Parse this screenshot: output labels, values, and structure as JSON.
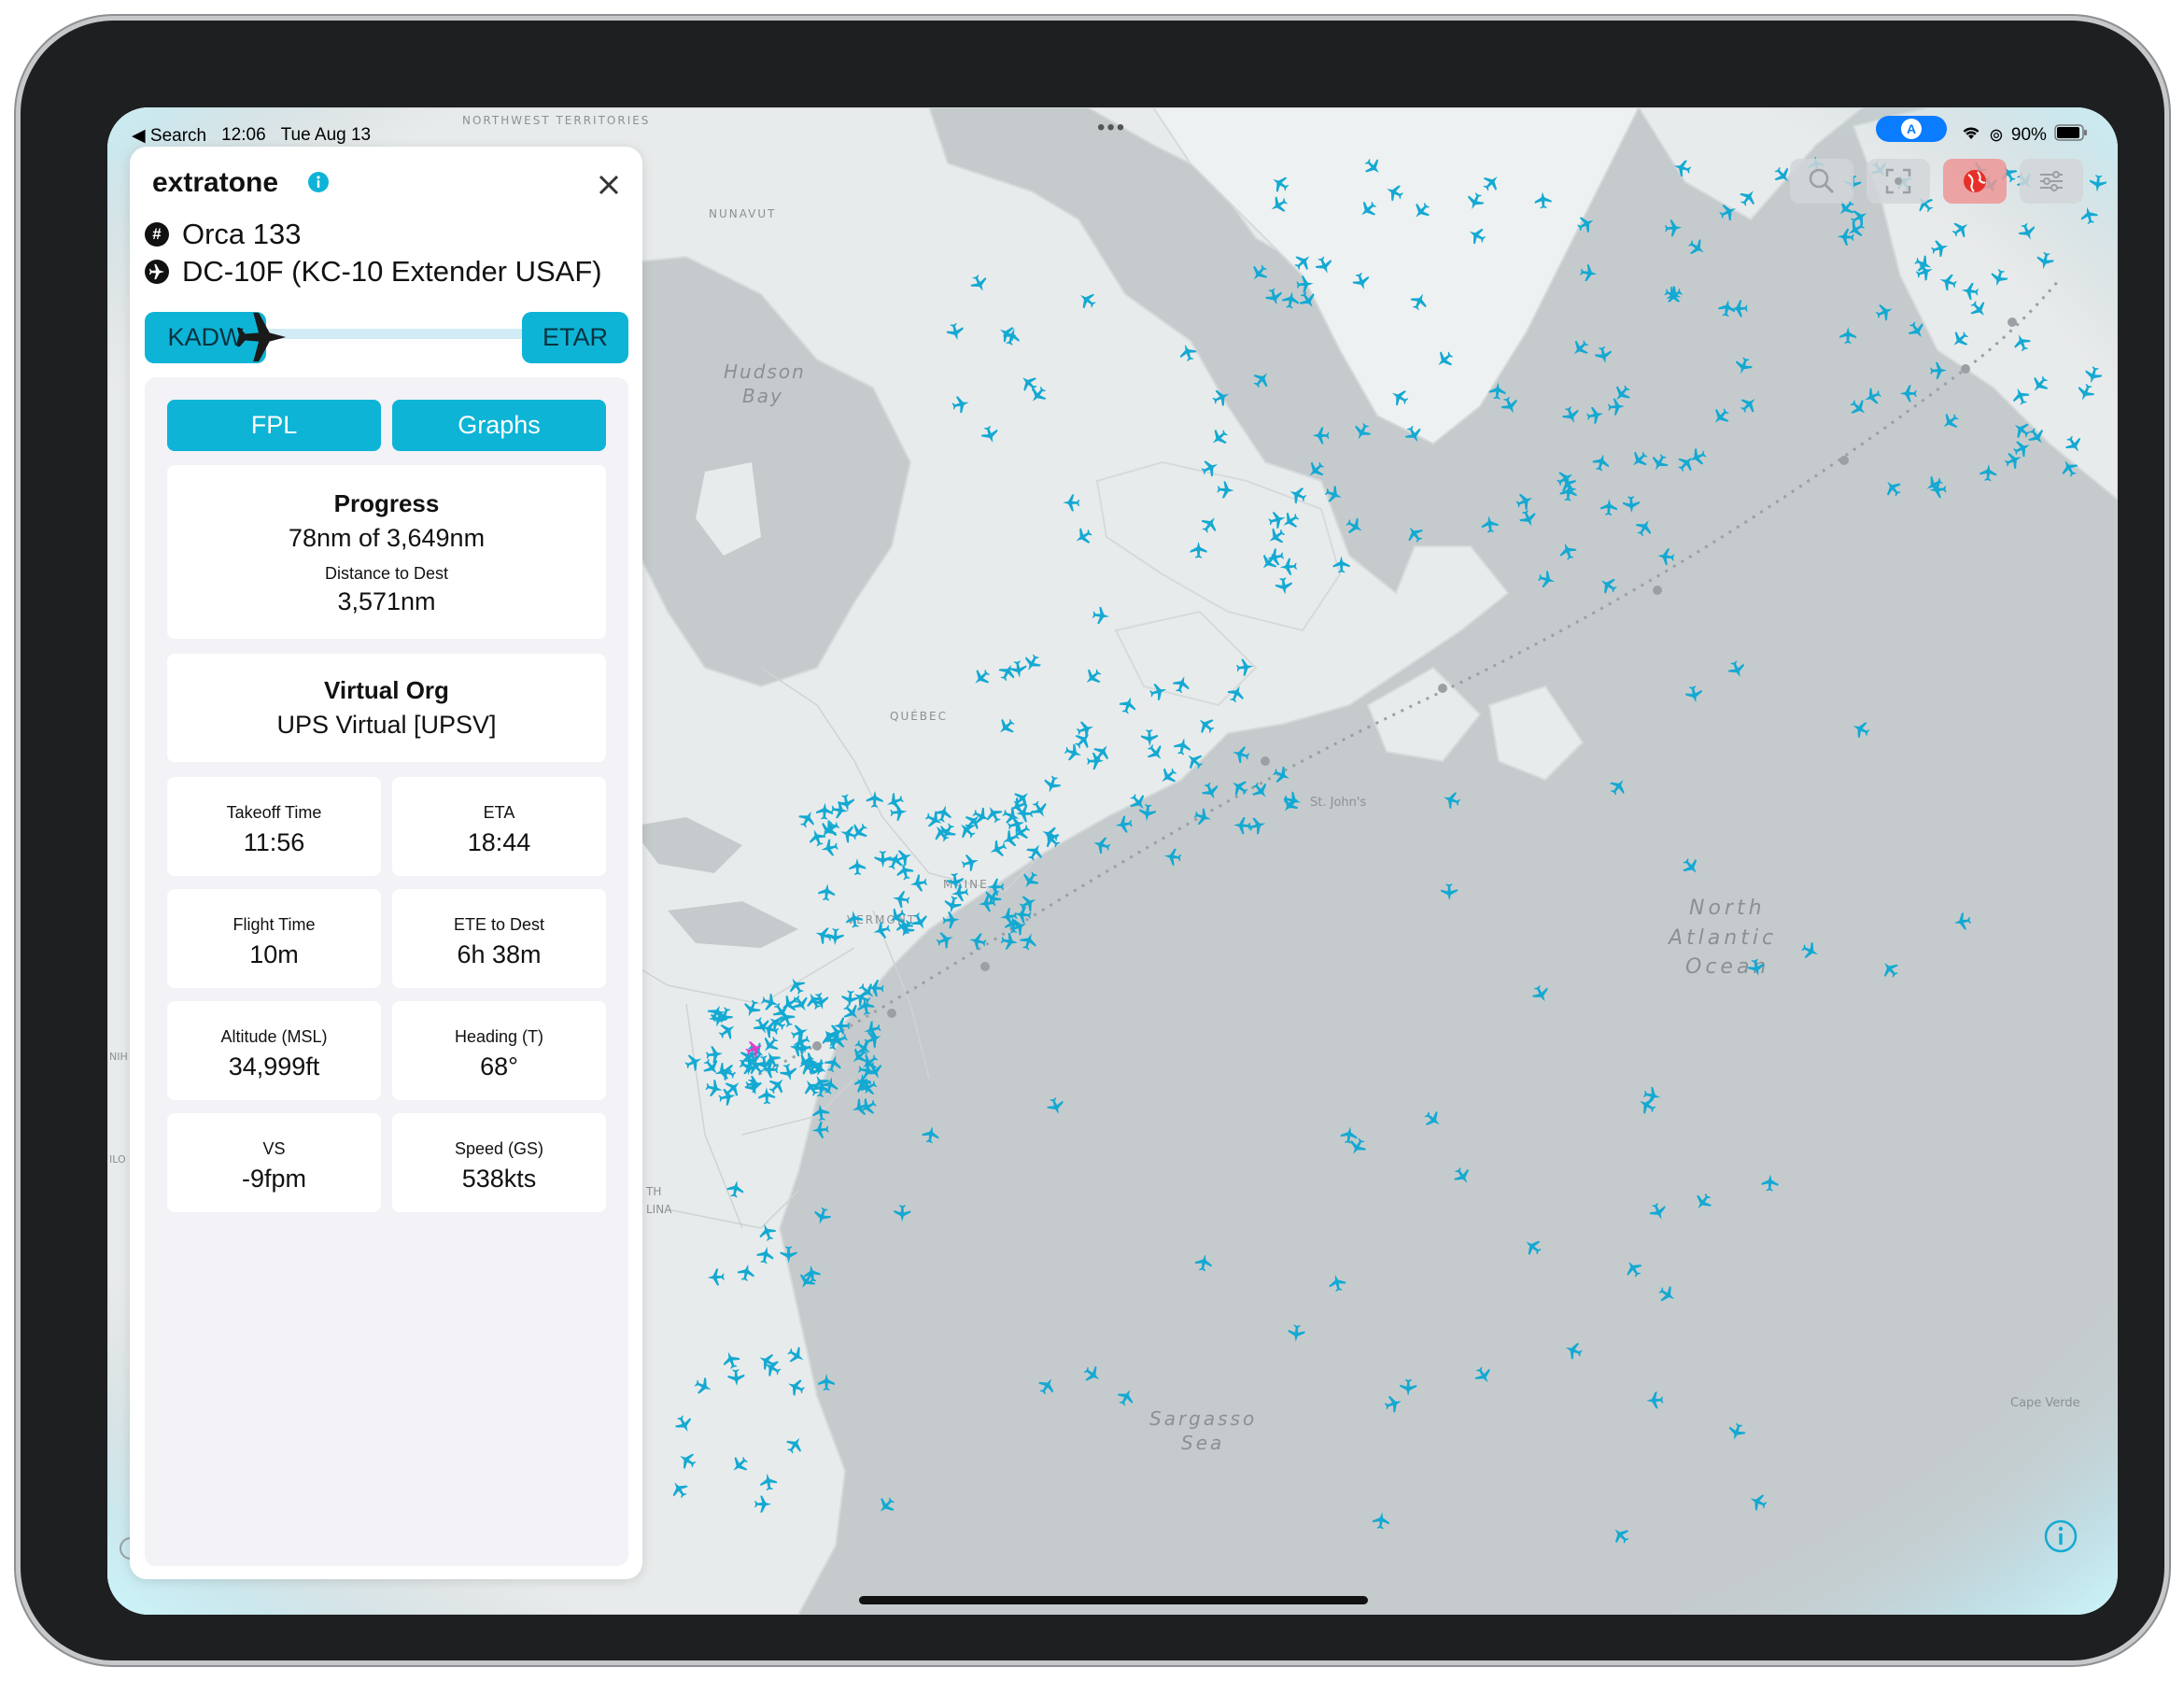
{
  "status_bar": {
    "back_label": "Search",
    "time": "12:06",
    "date": "Tue Aug 13",
    "battery": "90%"
  },
  "map": {
    "labels": {
      "northwest_territories": "NORTHWEST TERRITORIES",
      "nunavut": "NUNAVUT",
      "hudson_bay_1": "Hudson",
      "hudson_bay_2": "Bay",
      "quebec": "QUÉBEC",
      "maine": "MAINE",
      "vermont": "VERMONT",
      "st_johns": "St. John's",
      "north_atlantic_1": "North",
      "north_atlantic_2": "Atlantic",
      "north_atlantic_3": "Ocean",
      "sargasso_1": "Sargasso",
      "sargasso_2": "Sea",
      "cape_verde": "Cape Verde",
      "edge_1": "NIH",
      "edge_2": "ILO",
      "edge_3": "TH",
      "edge_4": "LINA"
    },
    "aircraft_color": "#14a9d2",
    "selected_color": "#e040c8",
    "route_color": "#9aa0a4"
  },
  "panel": {
    "username": "extratone",
    "callsign": "Orca 133",
    "aircraft": "DC-10F (KC-10 Extender USAF)",
    "origin": "KADW",
    "destination": "ETAR",
    "route_progress": 0.021,
    "tabs": {
      "fpl": "FPL",
      "graphs": "Graphs"
    },
    "progress": {
      "title": "Progress",
      "value": "78nm of 3,649nm",
      "dist_label": "Distance to Dest",
      "dist_value": "3,571nm"
    },
    "org": {
      "title": "Virtual Org",
      "value": "UPS Virtual [UPSV]"
    },
    "stats": [
      {
        "label": "Takeoff Time",
        "value": "11:56"
      },
      {
        "label": "ETA",
        "value": "18:44"
      },
      {
        "label": "Flight Time",
        "value": "10m"
      },
      {
        "label": "ETE to Dest",
        "value": "6h 38m"
      },
      {
        "label": "Altitude (MSL)",
        "value": "34,999ft"
      },
      {
        "label": "Heading (T)",
        "value": "68°"
      },
      {
        "label": "VS",
        "value": "-9fpm"
      },
      {
        "label": "Speed (GS)",
        "value": "538kts"
      }
    ]
  },
  "colors": {
    "accent": "#0eb4d6",
    "map_water": "#c5cbcd",
    "map_land": "#e9ecec",
    "globe_rim": "#ccf5fb"
  }
}
